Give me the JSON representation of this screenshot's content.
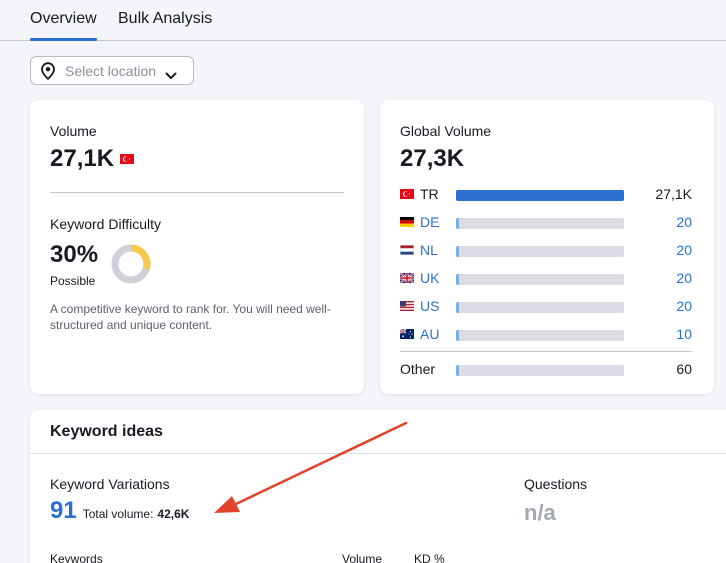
{
  "tabs": [
    {
      "label": "Overview",
      "active": true
    },
    {
      "label": "Bulk Analysis",
      "active": false
    }
  ],
  "location_select": {
    "placeholder": "Select location",
    "icon": "map-pin-icon"
  },
  "volume": {
    "label": "Volume",
    "value": "27,1K",
    "flag": "TR"
  },
  "keyword_difficulty": {
    "label": "Keyword Difficulty",
    "value": "30%",
    "level": "Possible",
    "percent": 30,
    "description": "A competitive keyword to rank for. You will need well-structured and unique content.",
    "colors": {
      "track": "#cfd1d9",
      "fill": "#f5c94e"
    }
  },
  "global_volume": {
    "label": "Global Volume",
    "value": "27,3K",
    "rows": [
      {
        "code": "TR",
        "value": "27,1K",
        "share": 1.0,
        "flag": "TR",
        "link": false
      },
      {
        "code": "DE",
        "value": "20",
        "share": 0.01,
        "flag": "DE",
        "link": true
      },
      {
        "code": "NL",
        "value": "20",
        "share": 0.01,
        "flag": "NL",
        "link": true
      },
      {
        "code": "UK",
        "value": "20",
        "share": 0.01,
        "flag": "UK",
        "link": true
      },
      {
        "code": "US",
        "value": "20",
        "share": 0.01,
        "flag": "US",
        "link": true
      },
      {
        "code": "AU",
        "value": "10",
        "share": 0.01,
        "flag": "AU",
        "link": true
      }
    ],
    "other": {
      "label": "Other",
      "value": "60",
      "share": 0.01
    }
  },
  "keyword_ideas": {
    "title": "Keyword ideas",
    "variations": {
      "label": "Keyword Variations",
      "count": "91",
      "total_label": "Total volume:",
      "total_value": "42,6K"
    },
    "questions": {
      "label": "Questions",
      "value": "n/a"
    },
    "columns": [
      "Keywords",
      "Volume",
      "KD %"
    ]
  },
  "colors": {
    "accent": "#2b6fd1",
    "arrow": "#e2432a"
  }
}
